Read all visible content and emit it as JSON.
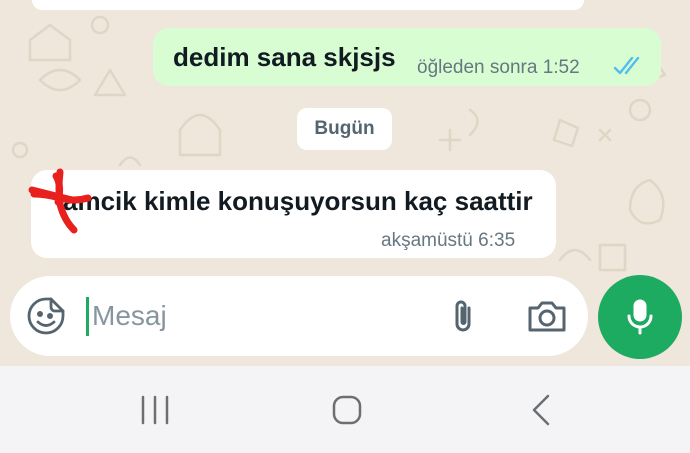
{
  "theme": {
    "outgoing_bubble": "#d9fdd3",
    "incoming_bubble": "#ffffff",
    "accent": "#1daa61",
    "read_ticks": "#53bdeb",
    "scribble": "#e8211f"
  },
  "messages": [
    {
      "direction": "outgoing",
      "text": "dedim sana skjsjs",
      "time": "öğleden sonra 1:52",
      "status_icon": "double-check-read-icon"
    },
    {
      "direction": "incoming",
      "text": "amcik kimle konuşuyorsun kaç saattir",
      "time": "akşamüstü 6:35",
      "annotation": "red-scribble-over-first-letter"
    }
  ],
  "date_divider": "Bugün",
  "composer": {
    "placeholder": "Mesaj",
    "value": "",
    "icons": [
      "sticker-emoji-icon",
      "paperclip-icon",
      "camera-icon"
    ]
  },
  "mic_button": {
    "icon": "microphone-icon"
  },
  "navigation_bar": {
    "buttons": [
      "recent-apps-icon",
      "home-icon",
      "back-icon"
    ]
  }
}
